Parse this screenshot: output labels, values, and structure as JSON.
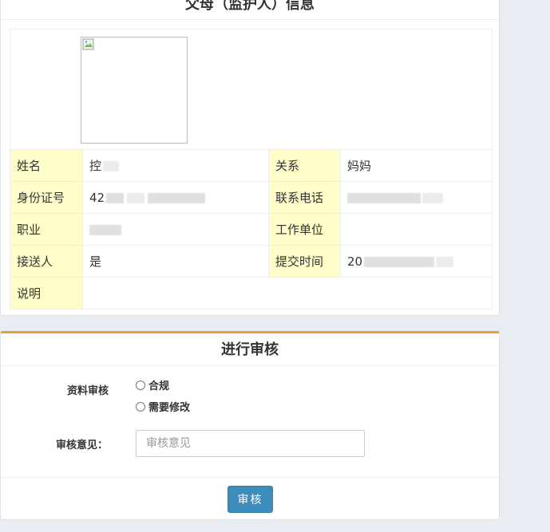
{
  "guardian_panel": {
    "title": "父母（监护人）信息",
    "photo_alt": "broken image",
    "fields": {
      "name_label": "姓名",
      "name_value": "控",
      "relation_label": "关系",
      "relation_value": "妈妈",
      "id_label": "身份证号",
      "id_value": "42",
      "phone_label": "联系电话",
      "job_label": "职业",
      "employer_label": "工作单位",
      "employer_value": "",
      "pickup_label": "接送人",
      "pickup_value": "是",
      "submit_time_label": "提交时间",
      "submit_time_value": "20",
      "note_label": "说明",
      "note_value": ""
    }
  },
  "review_panel": {
    "title": "进行审核",
    "review_label": "资料审核",
    "options": [
      "合规",
      "需要修改"
    ],
    "opinion_label": "审核意见：",
    "opinion_placeholder": "审核意见",
    "submit_label": "审核"
  },
  "colors": {
    "label_bg": "#fffdc9",
    "accent": "#e8a03a",
    "button": "#3c8dbc"
  }
}
